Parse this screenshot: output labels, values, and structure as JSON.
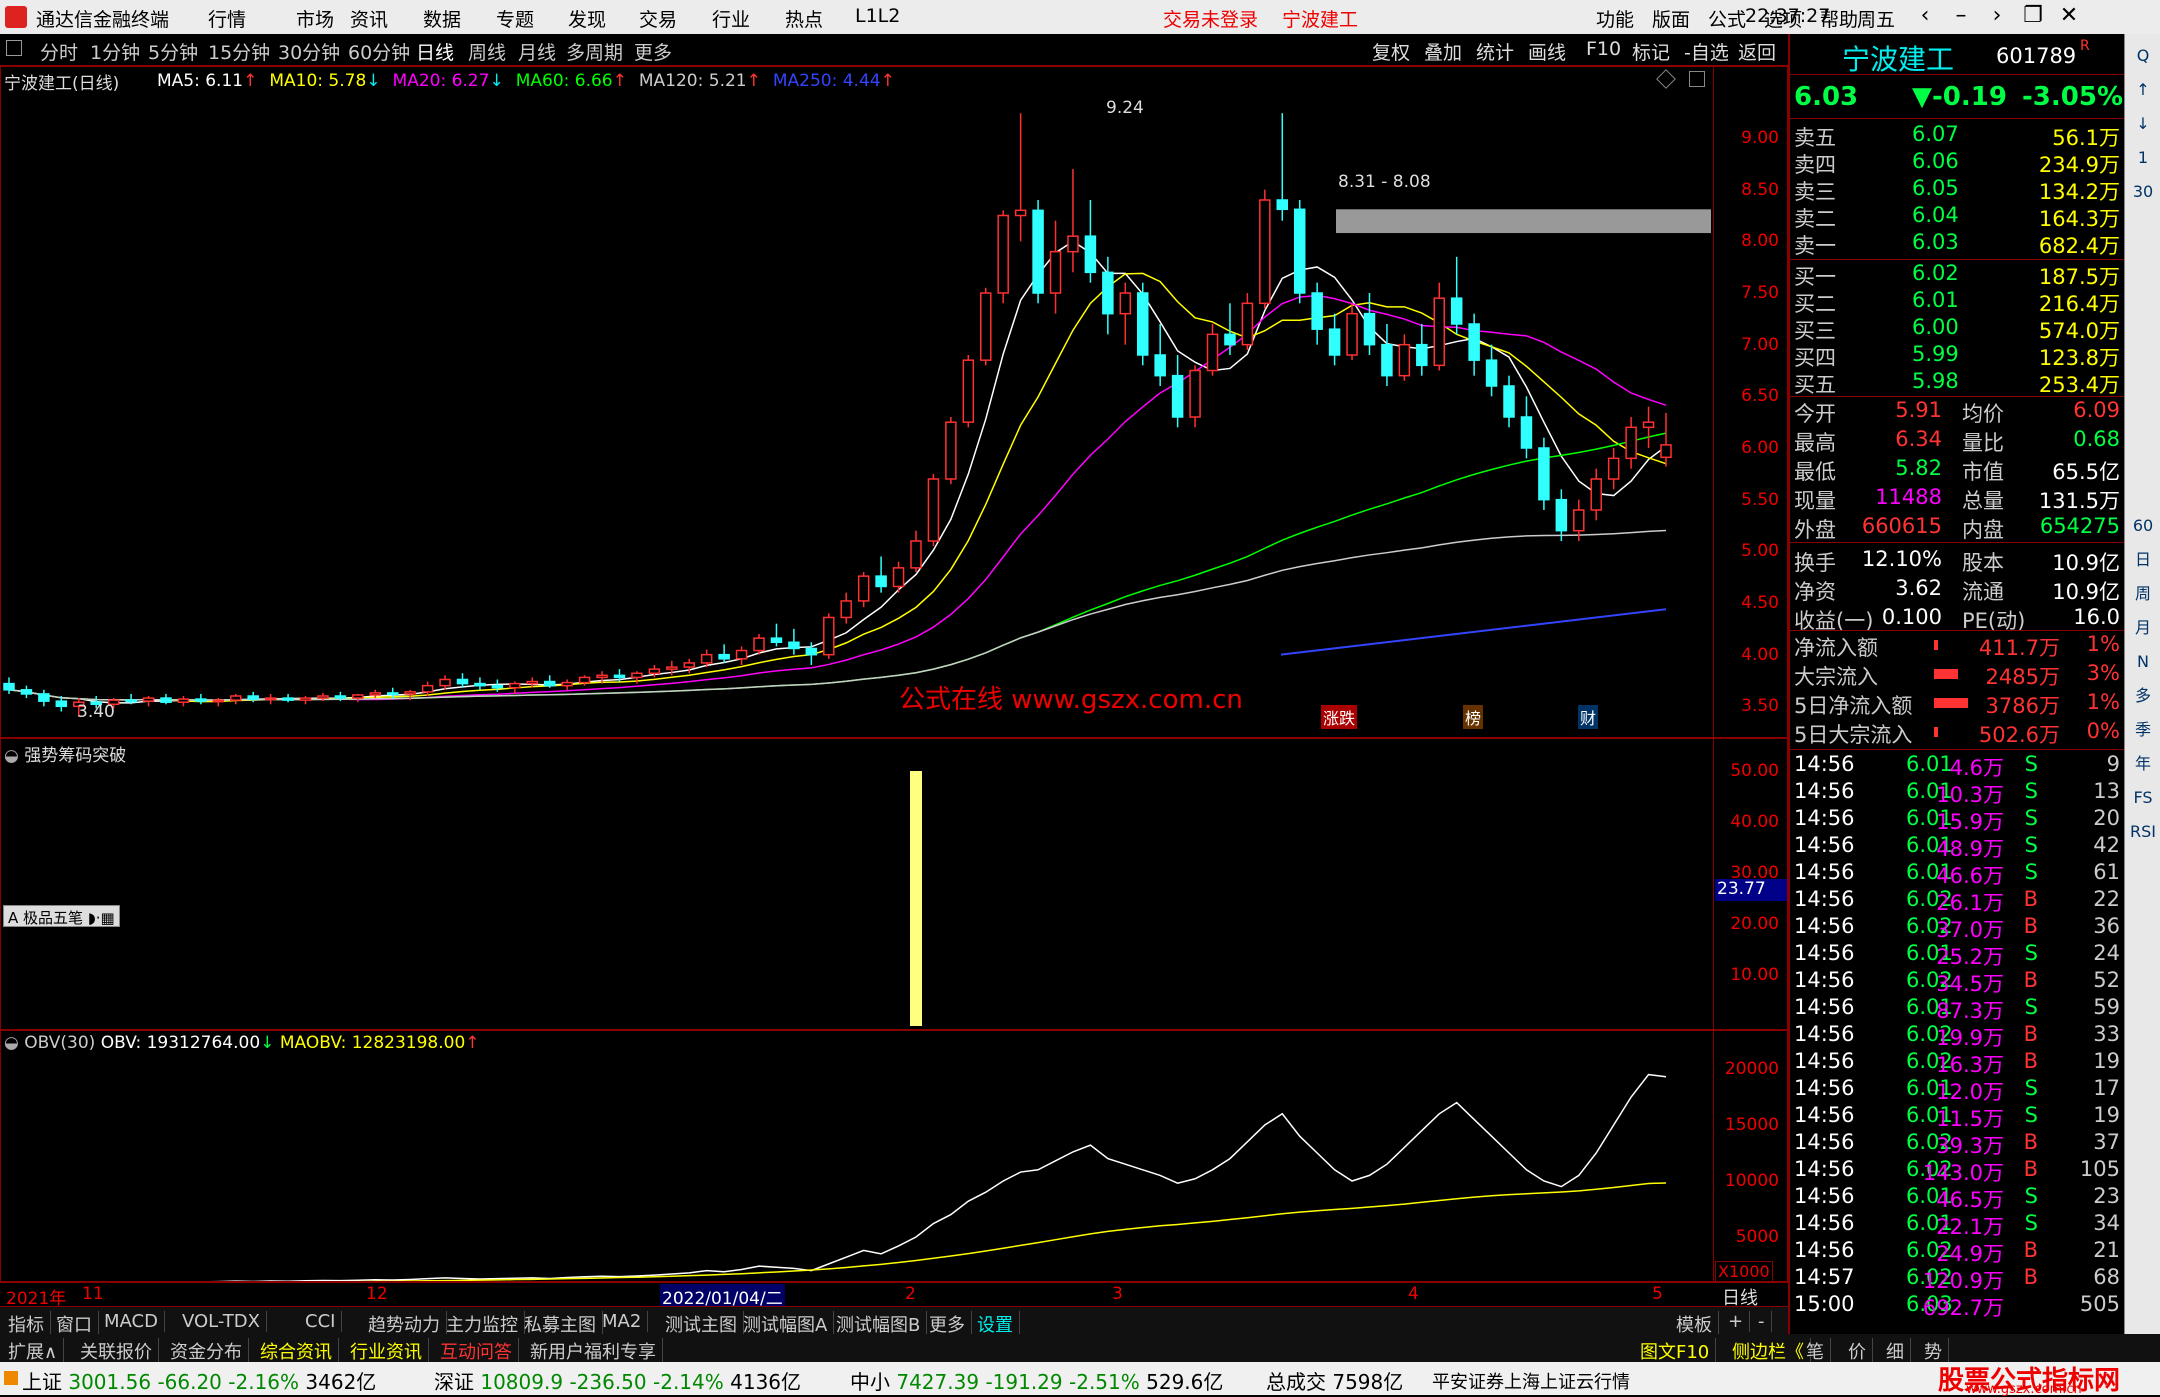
{
  "app": {
    "title": "通达信金融终端",
    "menus": [
      "行情",
      "市场",
      "资讯",
      "数据",
      "专题",
      "发现",
      "交易",
      "行业",
      "热点",
      "L1L2"
    ],
    "status_login": "交易未登录",
    "status_stock": "宁波建工",
    "right_menus": [
      "功能",
      "版面",
      "公式",
      "选项",
      "帮助"
    ],
    "clock": "22:37:27",
    "weekday": "周五"
  },
  "period_tabs": [
    "分时",
    "1分钟",
    "5分钟",
    "15分钟",
    "30分钟",
    "60分钟",
    "日线",
    "周线",
    "月线",
    "多周期",
    "更多"
  ],
  "active_period": "日线",
  "toolbar": [
    "复权",
    "叠加",
    "统计",
    "画线",
    "F10",
    "标记",
    "-自选",
    "返回"
  ],
  "main_chart": {
    "title": "宁波建工(日线)",
    "ma": [
      {
        "label": "MA5: 6.11",
        "color": "#ffffff",
        "arrow": "↑"
      },
      {
        "label": "MA10: 5.78",
        "color": "#ffff00",
        "arrow": "↓"
      },
      {
        "label": "MA20: 6.27",
        "color": "#ff00ff",
        "arrow": "↓"
      },
      {
        "label": "MA60: 6.66",
        "color": "#00ff00",
        "arrow": "↑"
      },
      {
        "label": "MA120: 5.21",
        "color": "#cccccc",
        "arrow": "↑"
      },
      {
        "label": "MA250: 4.44",
        "color": "#3344ff",
        "arrow": "↑"
      }
    ],
    "y_ticks": [
      "9.00",
      "8.50",
      "8.00",
      "7.50",
      "7.00",
      "6.50",
      "6.00",
      "5.50",
      "5.00",
      "4.50",
      "4.00",
      "3.50"
    ],
    "high_label": "9.24",
    "low_label": "3.40",
    "range_label": "8.31 - 8.08",
    "watermark": "公式在线 www.gszx.com.cn",
    "tags": [
      "涨跌",
      "榜",
      "财"
    ]
  },
  "panel2": {
    "title": "强势筹码突破",
    "y_ticks": [
      "50.00",
      "40.00",
      "30.00",
      "20.00",
      "10.00"
    ],
    "current": "23.77",
    "tool": "极品五笔"
  },
  "panel3": {
    "title": "OBV(30)",
    "obv": "OBV: 19312764.00",
    "arrow1": "↓",
    "maobv": "MAOBV: 12823198.00",
    "arrow2": "↑",
    "y_ticks": [
      "20000",
      "15000",
      "10000",
      "5000"
    ],
    "unit": "X1000"
  },
  "time_axis": [
    "2021年",
    "11",
    "12",
    "2022/01/04/二",
    "2",
    "3",
    "4",
    "5"
  ],
  "time_axis_right": "日线",
  "indicator_tabs": [
    "指标",
    "窗口",
    "MACD",
    "VOL-TDX",
    "CCI",
    "趋势动力",
    "主力监控",
    "私募主图",
    "MA2",
    "测试主图",
    "测试幅图A",
    "测试幅图B",
    "更多",
    "设置"
  ],
  "indicator_right": [
    "模板",
    "+",
    "-"
  ],
  "bottom_links": [
    "扩展∧",
    "关联报价",
    "资金分布",
    "综合资讯",
    "行业资讯",
    "互动问答",
    "新用户福利专享"
  ],
  "bottom_right": [
    "图文F10",
    "侧边栏《",
    "笔",
    "价",
    "细",
    "势"
  ],
  "quote": {
    "name": "宁波建工",
    "code": "601789",
    "flag": "R",
    "price": "6.03",
    "change": "▼-0.19",
    "pct": "-3.05%",
    "asks": [
      {
        "label": "卖五",
        "price": "6.07",
        "vol": "56.1万"
      },
      {
        "label": "卖四",
        "price": "6.06",
        "vol": "234.9万"
      },
      {
        "label": "卖三",
        "price": "6.05",
        "vol": "134.2万"
      },
      {
        "label": "卖二",
        "price": "6.04",
        "vol": "164.3万"
      },
      {
        "label": "卖一",
        "price": "6.03",
        "vol": "682.4万"
      }
    ],
    "bids": [
      {
        "label": "买一",
        "price": "6.02",
        "vol": "187.5万"
      },
      {
        "label": "买二",
        "price": "6.01",
        "vol": "216.4万"
      },
      {
        "label": "买三",
        "price": "6.00",
        "vol": "574.0万"
      },
      {
        "label": "买四",
        "price": "5.99",
        "vol": "123.8万"
      },
      {
        "label": "买五",
        "price": "5.98",
        "vol": "253.4万"
      }
    ],
    "stats": [
      {
        "l1": "今开",
        "v1": "5.91",
        "c1": "red",
        "l2": "均价",
        "v2": "6.09",
        "c2": "red"
      },
      {
        "l1": "最高",
        "v1": "6.34",
        "c1": "red",
        "l2": "量比",
        "v2": "0.68",
        "c2": "green"
      },
      {
        "l1": "最低",
        "v1": "5.82",
        "c1": "green",
        "l2": "市值",
        "v2": "65.5亿",
        "c2": "white"
      },
      {
        "l1": "现量",
        "v1": "11488",
        "c1": "mag",
        "l2": "总量",
        "v2": "131.5万",
        "c2": "white"
      },
      {
        "l1": "外盘",
        "v1": "660615",
        "c1": "red",
        "l2": "内盘",
        "v2": "654275",
        "c2": "green"
      },
      {
        "l1": "换手",
        "v1": "12.10%",
        "c1": "white",
        "l2": "股本",
        "v2": "10.9亿",
        "c2": "white"
      },
      {
        "l1": "净资",
        "v1": "3.62",
        "c1": "white",
        "l2": "流通",
        "v2": "10.9亿",
        "c2": "white"
      },
      {
        "l1": "收益(一)",
        "v1": "0.100",
        "c1": "white",
        "l2": "PE(动)",
        "v2": "16.0",
        "c2": "white"
      }
    ],
    "flows": [
      {
        "label": "净流入额",
        "val": "411.7万",
        "pct": "1%"
      },
      {
        "label": "大宗流入",
        "val": "2485万",
        "pct": "3%"
      },
      {
        "label": "5日净流入额",
        "val": "3786万",
        "pct": "1%"
      },
      {
        "label": "5日大宗流入",
        "val": "502.6万",
        "pct": "0%"
      }
    ],
    "ticks": [
      [
        "14:56",
        "6.01",
        "4.6万",
        "S",
        "9"
      ],
      [
        "14:56",
        "6.01",
        "10.3万",
        "S",
        "13"
      ],
      [
        "14:56",
        "6.01",
        "15.9万",
        "S",
        "20"
      ],
      [
        "14:56",
        "6.01",
        "48.9万",
        "S",
        "42"
      ],
      [
        "14:56",
        "6.01",
        "46.6万",
        "S",
        "61"
      ],
      [
        "14:56",
        "6.02",
        "26.1万",
        "B",
        "22"
      ],
      [
        "14:56",
        "6.02",
        "37.0万",
        "B",
        "36"
      ],
      [
        "14:56",
        "6.01",
        "25.2万",
        "S",
        "24"
      ],
      [
        "14:56",
        "6.02",
        "34.5万",
        "B",
        "52"
      ],
      [
        "14:56",
        "6.01",
        "87.3万",
        "S",
        "59"
      ],
      [
        "14:56",
        "6.02",
        "19.9万",
        "B",
        "33"
      ],
      [
        "14:56",
        "6.02",
        "16.3万",
        "B",
        "19"
      ],
      [
        "14:56",
        "6.01",
        "12.0万",
        "S",
        "17"
      ],
      [
        "14:56",
        "6.01",
        "11.5万",
        "S",
        "19"
      ],
      [
        "14:56",
        "6.02",
        "39.3万",
        "B",
        "37"
      ],
      [
        "14:56",
        "6.02",
        "143.0万",
        "B",
        "105"
      ],
      [
        "14:56",
        "6.01",
        "46.5万",
        "S",
        "23"
      ],
      [
        "14:56",
        "6.01",
        "22.1万",
        "S",
        "34"
      ],
      [
        "14:56",
        "6.02",
        "24.9万",
        "B",
        "21"
      ],
      [
        "14:57",
        "6.02",
        "120.9万",
        "B",
        "68"
      ],
      [
        "15:00",
        "6.03",
        "692.7万",
        "",
        "505"
      ]
    ]
  },
  "sidebar_items": [
    "Q",
    "↑",
    "↓",
    "1",
    "30",
    "60",
    "日",
    "周",
    "月",
    "N",
    "多",
    "季",
    "年",
    "FS",
    "RSI"
  ],
  "statusbar": {
    "sh_label": "上证",
    "sh_val": "3001.56",
    "sh_chg": "-66.20",
    "sh_pct": "-2.16%",
    "sh_amt": "3462亿",
    "sz_label": "深证",
    "sz_val": "10809.9",
    "sz_chg": "-236.50",
    "sz_pct": "-2.14%",
    "sz_amt": "4136亿",
    "zx_label": "中小",
    "zx_val": "7427.39",
    "zx_chg": "-191.29",
    "zx_pct": "-2.51%",
    "zx_amt": "529.6亿",
    "total_label": "总成交",
    "total_val": "7598亿",
    "broker": "平安证券上海上证云行情",
    "brand": "股票公式指标网",
    "brand_url": "www.gszx.com.cn"
  },
  "chart_data": {
    "type": "candlestick",
    "price_min": 3.3,
    "price_max": 9.3,
    "candles": [
      [
        3.72,
        3.78,
        3.62,
        3.66
      ],
      [
        3.66,
        3.7,
        3.58,
        3.62
      ],
      [
        3.62,
        3.66,
        3.5,
        3.55
      ],
      [
        3.55,
        3.6,
        3.45,
        3.5
      ],
      [
        3.5,
        3.58,
        3.4,
        3.54
      ],
      [
        3.54,
        3.6,
        3.48,
        3.52
      ],
      [
        3.52,
        3.58,
        3.48,
        3.56
      ],
      [
        3.56,
        3.62,
        3.52,
        3.55
      ],
      [
        3.55,
        3.6,
        3.5,
        3.58
      ],
      [
        3.58,
        3.62,
        3.52,
        3.54
      ],
      [
        3.54,
        3.6,
        3.5,
        3.57
      ],
      [
        3.57,
        3.62,
        3.52,
        3.55
      ],
      [
        3.55,
        3.58,
        3.5,
        3.56
      ],
      [
        3.56,
        3.62,
        3.52,
        3.6
      ],
      [
        3.6,
        3.64,
        3.54,
        3.57
      ],
      [
        3.57,
        3.62,
        3.52,
        3.58
      ],
      [
        3.58,
        3.62,
        3.54,
        3.56
      ],
      [
        3.56,
        3.6,
        3.52,
        3.58
      ],
      [
        3.58,
        3.63,
        3.55,
        3.6
      ],
      [
        3.6,
        3.64,
        3.55,
        3.58
      ],
      [
        3.58,
        3.62,
        3.54,
        3.61
      ],
      [
        3.61,
        3.66,
        3.58,
        3.63
      ],
      [
        3.63,
        3.68,
        3.58,
        3.62
      ],
      [
        3.62,
        3.66,
        3.56,
        3.64
      ],
      [
        3.64,
        3.74,
        3.6,
        3.7
      ],
      [
        3.7,
        3.8,
        3.66,
        3.76
      ],
      [
        3.76,
        3.82,
        3.68,
        3.72
      ],
      [
        3.72,
        3.78,
        3.66,
        3.7
      ],
      [
        3.7,
        3.76,
        3.64,
        3.68
      ],
      [
        3.68,
        3.74,
        3.62,
        3.72
      ],
      [
        3.72,
        3.78,
        3.68,
        3.74
      ],
      [
        3.74,
        3.8,
        3.68,
        3.7
      ],
      [
        3.7,
        3.76,
        3.66,
        3.73
      ],
      [
        3.73,
        3.8,
        3.7,
        3.78
      ],
      [
        3.78,
        3.84,
        3.72,
        3.8
      ],
      [
        3.8,
        3.86,
        3.74,
        3.78
      ],
      [
        3.78,
        3.84,
        3.72,
        3.82
      ],
      [
        3.82,
        3.9,
        3.78,
        3.86
      ],
      [
        3.86,
        3.94,
        3.8,
        3.88
      ],
      [
        3.88,
        3.96,
        3.82,
        3.92
      ],
      [
        3.92,
        4.05,
        3.88,
        4.0
      ],
      [
        4.0,
        4.1,
        3.92,
        3.96
      ],
      [
        3.96,
        4.08,
        3.9,
        4.04
      ],
      [
        4.04,
        4.2,
        4.0,
        4.16
      ],
      [
        4.16,
        4.3,
        4.08,
        4.12
      ],
      [
        4.12,
        4.25,
        4.0,
        4.06
      ],
      [
        4.06,
        4.12,
        3.9,
        4.0
      ],
      [
        4.0,
        4.4,
        3.96,
        4.36
      ],
      [
        4.36,
        4.6,
        4.3,
        4.52
      ],
      [
        4.52,
        4.8,
        4.46,
        4.76
      ],
      [
        4.76,
        4.95,
        4.6,
        4.66
      ],
      [
        4.66,
        4.9,
        4.6,
        4.84
      ],
      [
        4.84,
        5.2,
        4.8,
        5.1
      ],
      [
        5.1,
        5.75,
        5.05,
        5.7
      ],
      [
        5.7,
        6.3,
        5.65,
        6.25
      ],
      [
        6.25,
        6.9,
        6.2,
        6.85
      ],
      [
        6.85,
        7.55,
        6.8,
        7.5
      ],
      [
        7.5,
        8.3,
        7.4,
        8.25
      ],
      [
        8.25,
        9.24,
        8.0,
        8.3
      ],
      [
        8.3,
        8.4,
        7.4,
        7.5
      ],
      [
        7.5,
        8.2,
        7.3,
        7.9
      ],
      [
        7.9,
        8.7,
        7.7,
        8.05
      ],
      [
        8.05,
        8.4,
        7.6,
        7.7
      ],
      [
        7.7,
        7.85,
        7.1,
        7.3
      ],
      [
        7.3,
        7.6,
        7.0,
        7.5
      ],
      [
        7.5,
        7.6,
        6.8,
        6.9
      ],
      [
        6.9,
        7.2,
        6.6,
        6.7
      ],
      [
        6.7,
        6.9,
        6.2,
        6.3
      ],
      [
        6.3,
        6.8,
        6.2,
        6.75
      ],
      [
        6.75,
        7.2,
        6.7,
        7.1
      ],
      [
        7.1,
        7.4,
        6.9,
        7.0
      ],
      [
        7.0,
        7.5,
        6.95,
        7.4
      ],
      [
        7.4,
        8.5,
        7.35,
        8.4
      ],
      [
        8.4,
        9.24,
        8.2,
        8.31
      ],
      [
        8.31,
        8.4,
        7.4,
        7.5
      ],
      [
        7.5,
        7.6,
        7.0,
        7.15
      ],
      [
        7.15,
        7.3,
        6.8,
        6.9
      ],
      [
        6.9,
        7.4,
        6.85,
        7.3
      ],
      [
        7.3,
        7.5,
        6.9,
        7.0
      ],
      [
        7.0,
        7.2,
        6.6,
        6.7
      ],
      [
        6.7,
        7.1,
        6.65,
        7.0
      ],
      [
        7.0,
        7.2,
        6.7,
        6.8
      ],
      [
        6.8,
        7.6,
        6.75,
        7.45
      ],
      [
        7.45,
        7.85,
        7.1,
        7.2
      ],
      [
        7.2,
        7.3,
        6.7,
        6.85
      ],
      [
        6.85,
        7.0,
        6.5,
        6.6
      ],
      [
        6.6,
        6.7,
        6.2,
        6.3
      ],
      [
        6.3,
        6.5,
        5.9,
        6.0
      ],
      [
        6.0,
        6.1,
        5.4,
        5.5
      ],
      [
        5.5,
        5.6,
        5.1,
        5.2
      ],
      [
        5.2,
        5.5,
        5.1,
        5.4
      ],
      [
        5.4,
        5.8,
        5.3,
        5.7
      ],
      [
        5.7,
        6.0,
        5.6,
        5.9
      ],
      [
        5.9,
        6.3,
        5.8,
        6.2
      ],
      [
        6.2,
        6.4,
        6.0,
        6.25
      ],
      [
        5.91,
        6.34,
        5.82,
        6.03
      ]
    ],
    "panel2_bar": {
      "index": 52,
      "value": 50
    },
    "obv": [
      100,
      100,
      95,
      90,
      95,
      92,
      98,
      96,
      100,
      97,
      101,
      99,
      102,
      106,
      103,
      107,
      105,
      109,
      112,
      110,
      114,
      118,
      116,
      121,
      128,
      135,
      130,
      125,
      128,
      132,
      135,
      130,
      138,
      145,
      150,
      146,
      152,
      160,
      170,
      180,
      200,
      190,
      210,
      240,
      230,
      220,
      200,
      260,
      320,
      380,
      350,
      420,
      500,
      620,
      700,
      820,
      900,
      1000,
      1080,
      1100,
      1180,
      1260,
      1320,
      1200,
      1150,
      1100,
      1050,
      980,
      1020,
      1100,
      1200,
      1350,
      1500,
      1600,
      1400,
      1250,
      1100,
      1000,
      1050,
      1150,
      1300,
      1450,
      1600,
      1700,
      1550,
      1400,
      1250,
      1100,
      1000,
      950,
      1050,
      1250,
      1500,
      1750,
      1950,
      1931
    ],
    "maobv": [
      90,
      90,
      90,
      90,
      91,
      91,
      92,
      92,
      93,
      93,
      94,
      94,
      95,
      95,
      96,
      97,
      98,
      99,
      100,
      101,
      102,
      104,
      105,
      107,
      109,
      111,
      113,
      115,
      117,
      120,
      122,
      125,
      128,
      131,
      134,
      138,
      141,
      145,
      150,
      155,
      160,
      166,
      172,
      180,
      188,
      196,
      205,
      215,
      228,
      242,
      256,
      272,
      290,
      310,
      330,
      352,
      375,
      400,
      425,
      450,
      476,
      502,
      528,
      550,
      568,
      585,
      600,
      612,
      626,
      640,
      656,
      672,
      690,
      708,
      722,
      734,
      746,
      756,
      768,
      780,
      794,
      810,
      826,
      842,
      856,
      868,
      878,
      886,
      894,
      902,
      912,
      926,
      942,
      960,
      978,
      982
    ]
  }
}
